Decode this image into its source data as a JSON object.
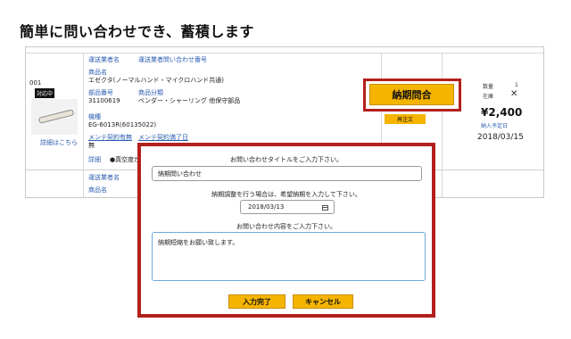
{
  "headline": "簡単に問い合わせでき、蓄積します",
  "row": {
    "number": "001",
    "badge": "対応中",
    "detail_link": "詳細はこちら",
    "carrier_label": "運送業者名",
    "tracking_label": "運送業者問い合わせ番号",
    "product_label": "商品名",
    "product_name": "エゼクタ(ノーマルハンド・マイクロハンド共通)",
    "part_no_label": "部品番号",
    "part_no": "31100619",
    "category_label": "商品分類",
    "category": "ベンダー・シャーリング 他保守部品",
    "model_label": "機種",
    "model": "EG-6013R(60135022)",
    "maintenance_label": "メンテ契約有無",
    "maintenance_value": "無",
    "maint_expiry_label": "メンテ契約満了日",
    "detail_label": "詳細",
    "detail_value": "●真空度が"
  },
  "actions": {
    "delivery_inquiry": "納期問合",
    "reorder": "再注文"
  },
  "stock": {
    "qty_label": "数量",
    "qty_value": "1",
    "stock_label": "在庫",
    "price": "¥2,400",
    "eta_label": "納入予定日",
    "eta": "2018/03/15"
  },
  "next_row": {
    "carrier_label": "運送業者名",
    "product_label": "商品名"
  },
  "modal": {
    "title_prompt": "お問い合わせタイトルをご入力下さい。",
    "title_value": "納期問い合わせ",
    "date_prompt": "納期調整を行う場合は、希望納期を入力して下さい。",
    "date_value": "2018/03/13",
    "content_prompt": "お問い合わせ内容をご入力下さい。",
    "content_value": "納期短縮をお願い致します。",
    "confirm": "入力完了",
    "cancel": "キャンセル"
  },
  "colors": {
    "highlight": "#b3201c",
    "button": "#f5b400",
    "link": "#2a5db0"
  }
}
